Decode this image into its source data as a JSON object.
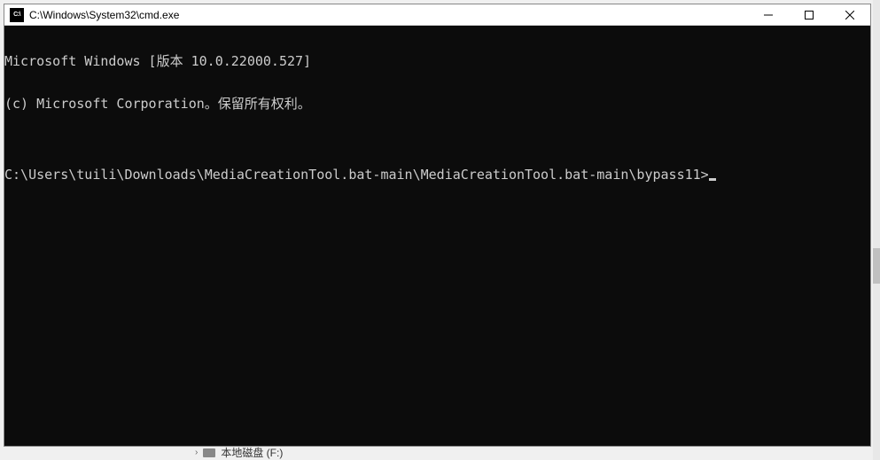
{
  "titlebar": {
    "icon_label": "C:\\",
    "title": "C:\\Windows\\System32\\cmd.exe"
  },
  "terminal": {
    "line1": "Microsoft Windows [版本 10.0.22000.527]",
    "line2": "(c) Microsoft Corporation。保留所有权利。",
    "blank": "",
    "prompt": "C:\\Users\\tuili\\Downloads\\MediaCreationTool.bat-main\\MediaCreationTool.bat-main\\bypass11>"
  },
  "background": {
    "item_text": "本地磁盘 (F:)"
  }
}
